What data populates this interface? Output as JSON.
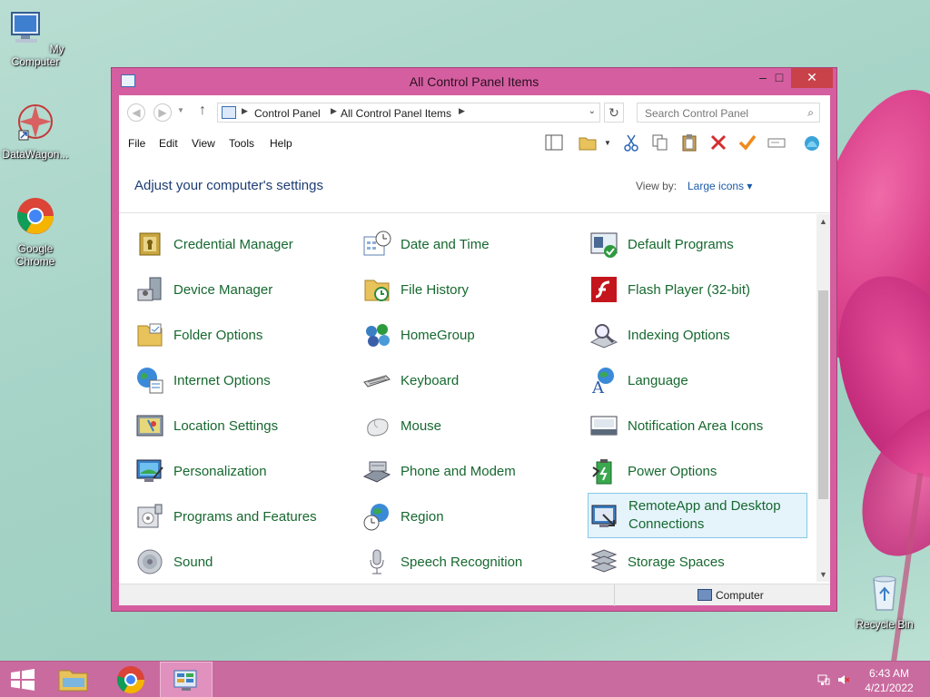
{
  "desktop": {
    "icons": [
      {
        "label": "My Computer"
      },
      {
        "label": "DataWagon..."
      },
      {
        "label": "Google Chrome"
      },
      {
        "label": "Recycle Bin"
      }
    ]
  },
  "window": {
    "title": "All Control Panel Items",
    "controls": {
      "minimize": "–",
      "maximize": "□",
      "close": "✕"
    }
  },
  "address": {
    "crumbs": [
      "Control Panel",
      "All Control Panel Items"
    ],
    "search_placeholder": "Search Control Panel"
  },
  "menu": [
    "File",
    "Edit",
    "View",
    "Tools",
    "Help"
  ],
  "header": {
    "title": "Adjust your computer's settings",
    "view_by_label": "View by:",
    "view_by_value": "Large icons ▾"
  },
  "items": [
    {
      "label": "Credential Manager",
      "icon": "credential-icon"
    },
    {
      "label": "Date and Time",
      "icon": "clock-icon"
    },
    {
      "label": "Default Programs",
      "icon": "default-programs-icon"
    },
    {
      "label": "Device Manager",
      "icon": "device-manager-icon"
    },
    {
      "label": "File History",
      "icon": "file-history-icon"
    },
    {
      "label": "Flash Player (32-bit)",
      "icon": "flash-icon"
    },
    {
      "label": "Folder Options",
      "icon": "folder-icon"
    },
    {
      "label": "HomeGroup",
      "icon": "homegroup-icon"
    },
    {
      "label": "Indexing Options",
      "icon": "indexing-icon"
    },
    {
      "label": "Internet Options",
      "icon": "globe-icon"
    },
    {
      "label": "Keyboard",
      "icon": "keyboard-icon"
    },
    {
      "label": "Language",
      "icon": "language-icon"
    },
    {
      "label": "Location Settings",
      "icon": "location-icon"
    },
    {
      "label": "Mouse",
      "icon": "mouse-icon"
    },
    {
      "label": "Notification Area Icons",
      "icon": "notification-icon"
    },
    {
      "label": "Personalization",
      "icon": "personalization-icon"
    },
    {
      "label": "Phone and Modem",
      "icon": "phone-icon"
    },
    {
      "label": "Power Options",
      "icon": "power-icon"
    },
    {
      "label": "Programs and Features",
      "icon": "programs-icon"
    },
    {
      "label": "Region",
      "icon": "region-icon"
    },
    {
      "label": "RemoteApp and Desktop Connections",
      "icon": "remoteapp-icon"
    },
    {
      "label": "Sound",
      "icon": "sound-icon"
    },
    {
      "label": "Speech Recognition",
      "icon": "microphone-icon"
    },
    {
      "label": "Storage Spaces",
      "icon": "storage-icon"
    }
  ],
  "status": {
    "location": "Computer"
  },
  "taskbar": {
    "time": "6:43 AM",
    "date": "4/21/2022"
  },
  "colors": {
    "window_frame": "#d45ea0",
    "item_text": "#16682f",
    "heading": "#1d3d73",
    "taskbar": "#c96b9f"
  }
}
